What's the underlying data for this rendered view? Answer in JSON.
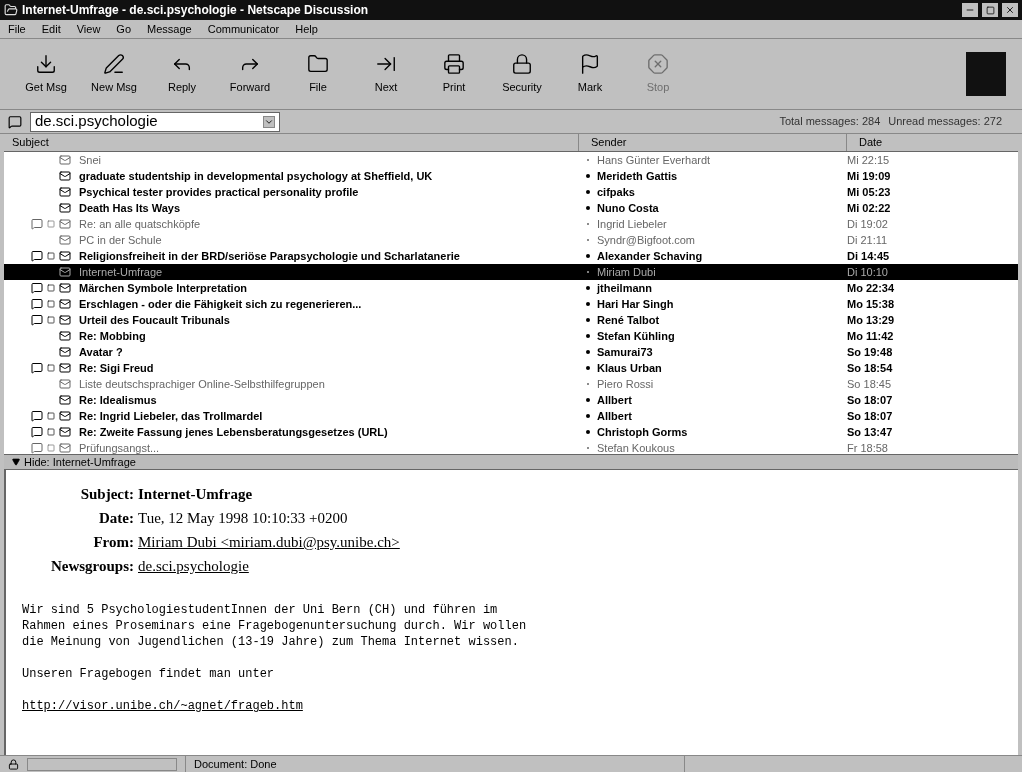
{
  "window": {
    "title": "Internet-Umfrage - de.sci.psychologie - Netscape Discussion"
  },
  "menu": [
    "File",
    "Edit",
    "View",
    "Go",
    "Message",
    "Communicator",
    "Help"
  ],
  "toolbar": [
    {
      "label": "Get Msg",
      "kind": "download",
      "disabled": false
    },
    {
      "label": "New Msg",
      "kind": "pen",
      "disabled": false
    },
    {
      "label": "Reply",
      "kind": "reply",
      "disabled": false
    },
    {
      "label": "Forward",
      "kind": "forward",
      "disabled": false
    },
    {
      "label": "File",
      "kind": "folder",
      "disabled": false
    },
    {
      "label": "Next",
      "kind": "next",
      "disabled": false
    },
    {
      "label": "Print",
      "kind": "print",
      "disabled": false
    },
    {
      "label": "Security",
      "kind": "lock",
      "disabled": false
    },
    {
      "label": "Mark",
      "kind": "flag",
      "disabled": false
    },
    {
      "label": "Stop",
      "kind": "stop",
      "disabled": true
    }
  ],
  "location": {
    "value": "de.sci.psychologie",
    "total": "Total messages: 284",
    "unread": "Unread messages: 272"
  },
  "columns": [
    "Subject",
    "Sender",
    "Date"
  ],
  "messages": [
    {
      "subject": "Snei",
      "sender": "Hans Günter Everhardt",
      "date": "Mi 22:15",
      "unread": false,
      "thread": false,
      "selected": false
    },
    {
      "subject": "graduate studentship in developmental psychology at Sheffield, UK",
      "sender": "Merideth Gattis",
      "date": "Mi 19:09",
      "unread": true,
      "thread": false,
      "selected": false
    },
    {
      "subject": "Psychical tester provides practical personality profile",
      "sender": "cifpaks",
      "date": "Mi 05:23",
      "unread": true,
      "thread": false,
      "selected": false
    },
    {
      "subject": "Death Has Its Ways",
      "sender": "Nuno Costa",
      "date": "Mi 02:22",
      "unread": true,
      "thread": false,
      "selected": false
    },
    {
      "subject": "Re: an alle quatschköpfe",
      "sender": "Ingrid Liebeler",
      "date": "Di 19:02",
      "unread": false,
      "thread": true,
      "selected": false
    },
    {
      "subject": "PC in der Schule",
      "sender": "Syndr@Bigfoot.com",
      "date": "Di 21:11",
      "unread": false,
      "thread": false,
      "selected": false
    },
    {
      "subject": "Religionsfreiheit in der BRD/seriöse Parapsychologie und Scharlatanerie",
      "sender": "Alexander Schaving",
      "date": "Di 14:45",
      "unread": true,
      "thread": true,
      "selected": false
    },
    {
      "subject": "Internet-Umfrage",
      "sender": "Miriam Dubi",
      "date": "Di 10:10",
      "unread": false,
      "thread": false,
      "selected": true
    },
    {
      "subject": "Märchen Symbole Interpretation",
      "sender": "jtheilmann",
      "date": "Mo 22:34",
      "unread": true,
      "thread": true,
      "selected": false
    },
    {
      "subject": "Erschlagen - oder die Fähigkeit sich zu regenerieren...",
      "sender": "Hari Har Singh",
      "date": "Mo 15:38",
      "unread": true,
      "thread": true,
      "selected": false
    },
    {
      "subject": "Urteil des Foucault Tribunals",
      "sender": "René Talbot",
      "date": "Mo 13:29",
      "unread": true,
      "thread": true,
      "selected": false
    },
    {
      "subject": "Re: Mobbing",
      "sender": "Stefan Kühling",
      "date": "Mo 11:42",
      "unread": true,
      "thread": false,
      "selected": false
    },
    {
      "subject": "Avatar ?",
      "sender": "Samurai73",
      "date": "So 19:48",
      "unread": true,
      "thread": false,
      "selected": false
    },
    {
      "subject": "Re: Sigi Freud",
      "sender": "Klaus Urban",
      "date": "So 18:54",
      "unread": true,
      "thread": true,
      "selected": false
    },
    {
      "subject": "Liste deutschsprachiger Online-Selbsthilfegruppen",
      "sender": "Piero Rossi",
      "date": "So 18:45",
      "unread": false,
      "thread": false,
      "selected": false
    },
    {
      "subject": "Re: Idealismus",
      "sender": "Allbert",
      "date": "So 18:07",
      "unread": true,
      "thread": false,
      "selected": false
    },
    {
      "subject": "Re: Ingrid Liebeler, das Trollmardel",
      "sender": "Allbert",
      "date": "So 18:07",
      "unread": true,
      "thread": true,
      "selected": false
    },
    {
      "subject": "Re: Zweite Fassung jenes Lebensberatungsgesetzes (URL)",
      "sender": "Christoph Gorms",
      "date": "So 13:47",
      "unread": true,
      "thread": true,
      "selected": false
    },
    {
      "subject": "Prüfungsangst...",
      "sender": "Stefan Koukous",
      "date": "Fr 18:58",
      "unread": false,
      "thread": true,
      "selected": false
    }
  ],
  "hide_bar": "Hide: Internet-Umfrage",
  "message": {
    "headers": [
      {
        "label": "Subject:",
        "value": "Internet-Umfrage",
        "kind": "bold"
      },
      {
        "label": "Date:",
        "value": "Tue, 12 May 1998 10:10:33 +0200",
        "kind": "plain"
      },
      {
        "label": "From:",
        "value": "Miriam Dubi <miriam.dubi@psy.unibe.ch>",
        "kind": "link"
      },
      {
        "label": "Newsgroups:",
        "value": "de.sci.psychologie",
        "kind": "link"
      }
    ],
    "paragraphs": [
      "Wir sind 5 PsychologiestudentInnen der Uni Bern (CH) und führen im\nRahmen eines Proseminars eine Fragebogenuntersuchung durch. Wir wollen\ndie Meinung von Jugendlichen (13-19 Jahre) zum Thema Internet wissen.",
      "Unseren Fragebogen findet man unter"
    ],
    "url": "http://visor.unibe.ch/~agnet/frageb.htm"
  },
  "progress": {
    "level": 0
  },
  "status_bar": "Document: Done"
}
